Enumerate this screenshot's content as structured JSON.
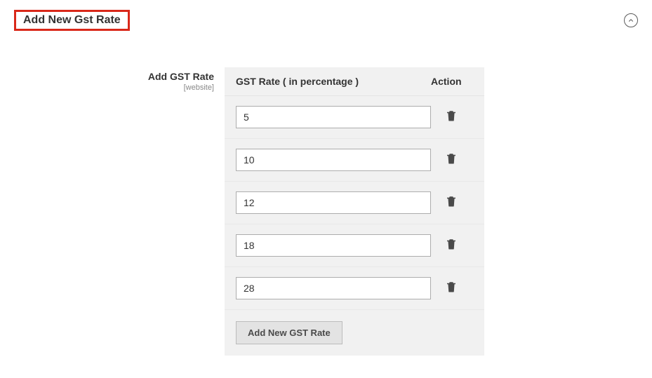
{
  "pageTitle": "Add New Gst Rate",
  "fieldLabel": "Add GST Rate",
  "fieldScope": "[website]",
  "columns": {
    "rate": "GST Rate ( in percentage )",
    "action": "Action"
  },
  "rates": [
    "5",
    "10",
    "12",
    "18",
    "28"
  ],
  "addButtonLabel": "Add New GST Rate"
}
